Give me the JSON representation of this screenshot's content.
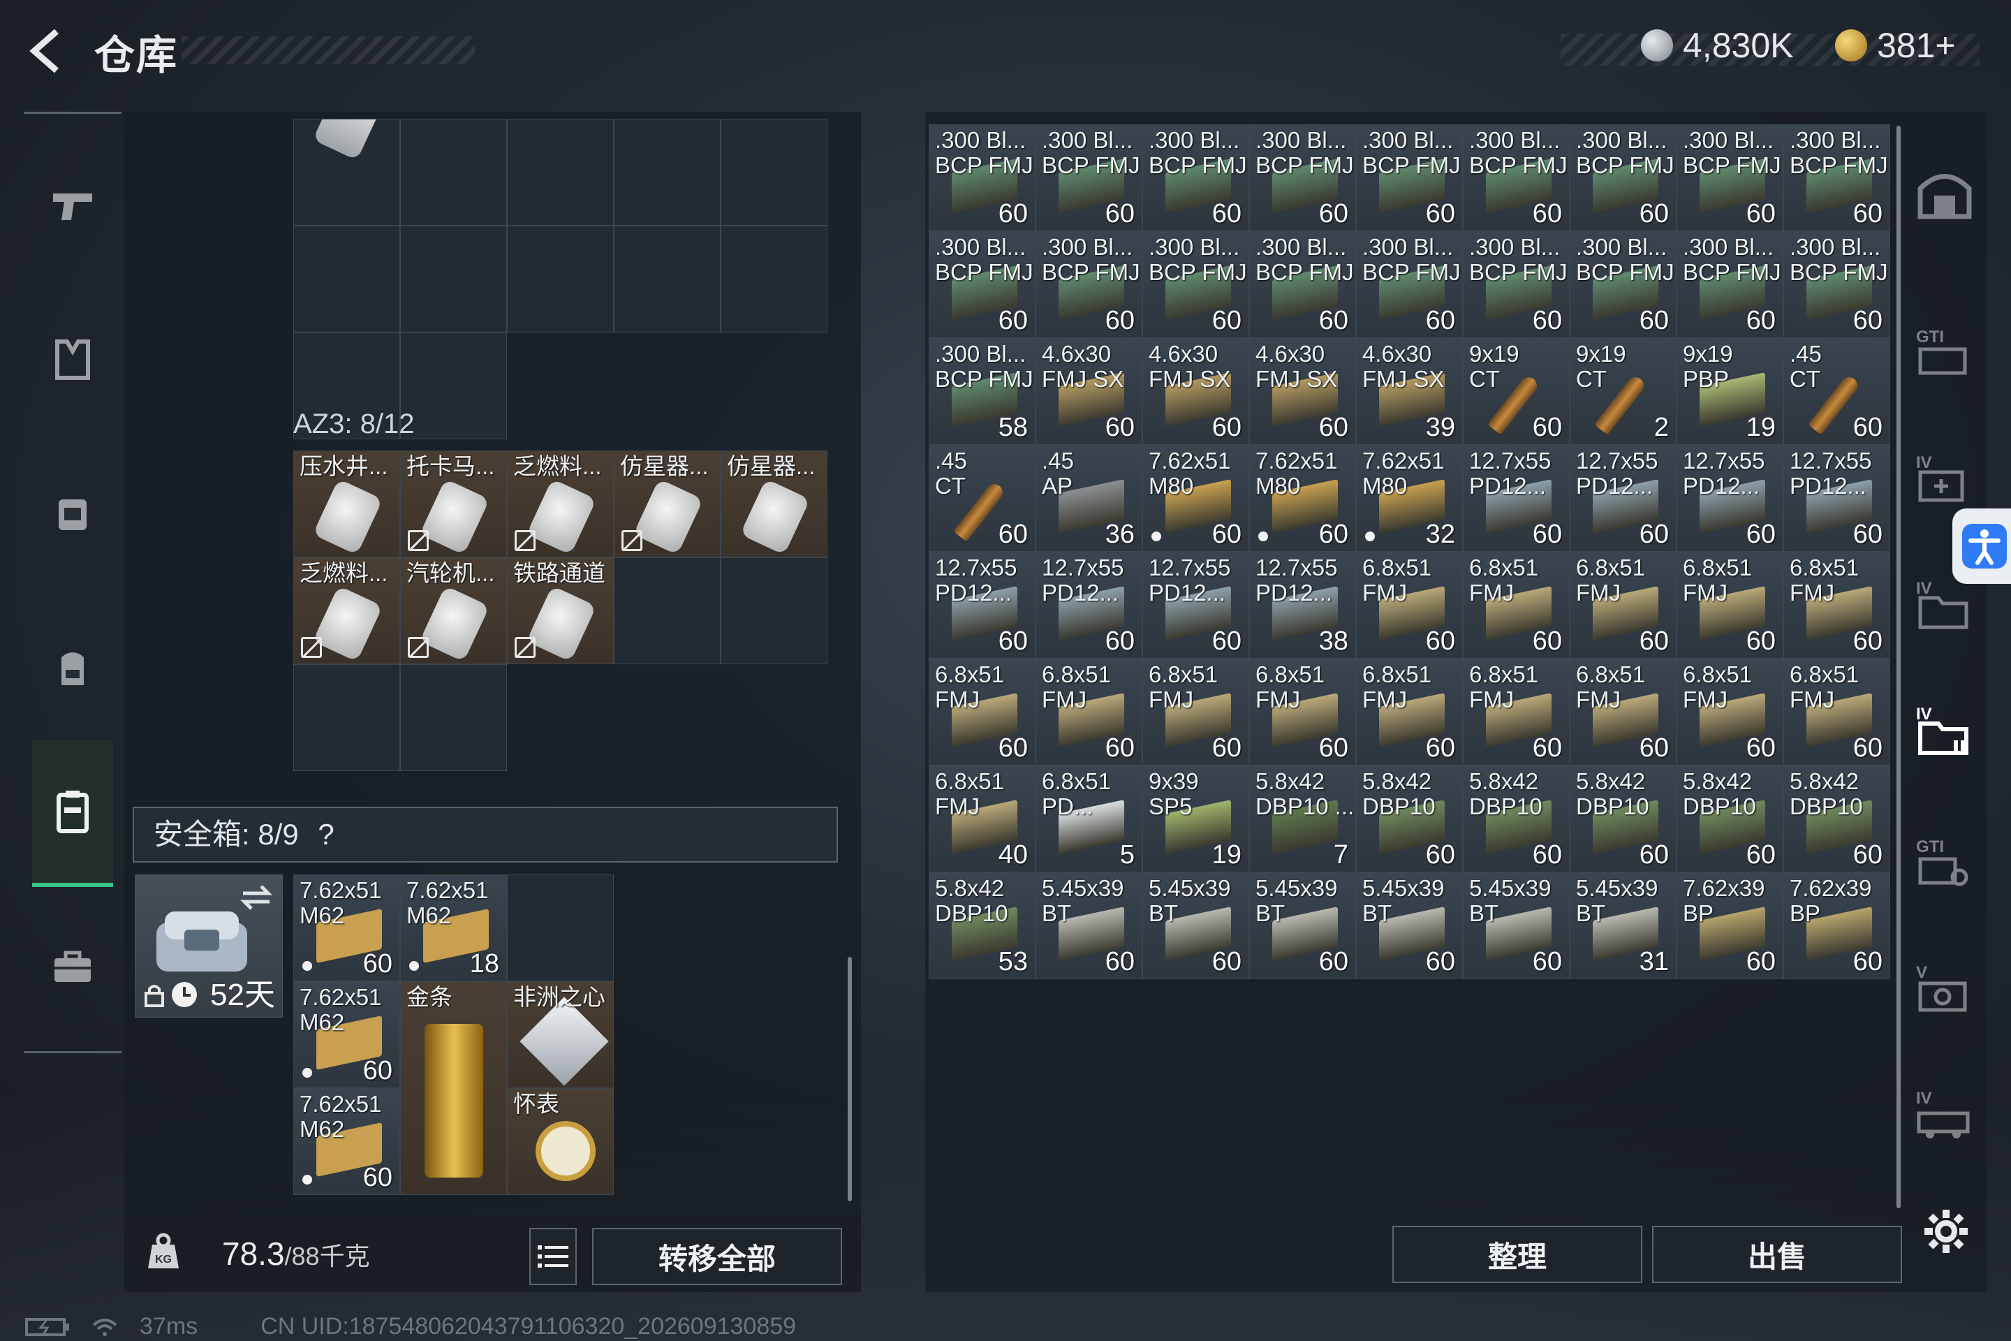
{
  "header": {
    "title": "仓库",
    "currency1": "4,830K",
    "currency2": "381+",
    "plus": "+"
  },
  "sidebar": [
    {
      "icon": "pistol-icon"
    },
    {
      "icon": "armor-vest-icon"
    },
    {
      "icon": "tactical-rig-icon"
    },
    {
      "icon": "backpack-icon"
    },
    {
      "icon": "container-icon"
    },
    {
      "icon": "briefcase-icon"
    }
  ],
  "left": {
    "az3_label": "AZ3: 8/12",
    "az3_items": [
      {
        "name": "压水井...",
        "nocard": false
      },
      {
        "name": "托卡马...",
        "nocard": true
      },
      {
        "name": "乏燃料...",
        "nocard": true
      },
      {
        "name": "仿星器...",
        "nocard": true
      },
      {
        "name": "仿星器...",
        "nocard": false
      },
      {
        "name": "乏燃料...",
        "nocard": true
      },
      {
        "name": "汽轮机...",
        "nocard": true
      },
      {
        "name": "铁路通道",
        "nocard": true
      }
    ],
    "safe_label": "安全箱: 8/9",
    "safe_help": "?",
    "case_days": "52天",
    "safe_items": [
      {
        "name": "7.62x51\nM62",
        "count": "60",
        "dot": true
      },
      {
        "name": "7.62x51\nM62",
        "count": "18",
        "dot": true
      },
      {
        "name": "7.62x51\nM62",
        "count": "60",
        "dot": true
      },
      {
        "name": "金条",
        "count": ""
      },
      {
        "name": "非洲之心",
        "count": ""
      },
      {
        "name": "7.62x51\nM62",
        "count": "60",
        "dot": true
      },
      {
        "name": "怀表",
        "count": ""
      }
    ],
    "weight_value": "78.3",
    "weight_cap": "/88千克",
    "transfer_all": "转移全部"
  },
  "stash": {
    "items": [
      {
        "name": ".300 Bl...\nBCP FMJ",
        "count": "60",
        "color": "#5f8a6e"
      },
      {
        "name": ".300 Bl...\nBCP FMJ",
        "count": "60",
        "color": "#5f8a6e"
      },
      {
        "name": ".300 Bl...\nBCP FMJ",
        "count": "60",
        "color": "#5f8a6e"
      },
      {
        "name": ".300 Bl...\nBCP FMJ",
        "count": "60",
        "color": "#5f8a6e"
      },
      {
        "name": ".300 Bl...\nBCP FMJ",
        "count": "60",
        "color": "#5f8a6e"
      },
      {
        "name": ".300 Bl...\nBCP FMJ",
        "count": "60",
        "color": "#5f8a6e"
      },
      {
        "name": ".300 Bl...\nBCP FMJ",
        "count": "60",
        "color": "#5f8a6e"
      },
      {
        "name": ".300 Bl...\nBCP FMJ",
        "count": "60",
        "color": "#5f8a6e"
      },
      {
        "name": ".300 Bl...\nBCP FMJ",
        "count": "60",
        "color": "#5f8a6e"
      },
      {
        "name": ".300 Bl...\nBCP FMJ",
        "count": "60",
        "color": "#5f8a6e"
      },
      {
        "name": ".300 Bl...\nBCP FMJ",
        "count": "60",
        "color": "#5f8a6e"
      },
      {
        "name": ".300 Bl...\nBCP FMJ",
        "count": "60",
        "color": "#5f8a6e"
      },
      {
        "name": ".300 Bl...\nBCP FMJ",
        "count": "60",
        "color": "#5f8a6e"
      },
      {
        "name": ".300 Bl...\nBCP FMJ",
        "count": "60",
        "color": "#5f8a6e"
      },
      {
        "name": ".300 Bl...\nBCP FMJ",
        "count": "60",
        "color": "#5f8a6e"
      },
      {
        "name": ".300 Bl...\nBCP FMJ",
        "count": "60",
        "color": "#5f8a6e"
      },
      {
        "name": ".300 Bl...\nBCP FMJ",
        "count": "60",
        "color": "#5f8a6e"
      },
      {
        "name": ".300 Bl...\nBCP FMJ",
        "count": "60",
        "color": "#5f8a6e"
      },
      {
        "name": ".300 Bl...\nBCP FMJ",
        "count": "58",
        "color": "#5f8a6e"
      },
      {
        "name": "4.6x30\nFMJ SX",
        "count": "60",
        "color": "#b49a62"
      },
      {
        "name": "4.6x30\nFMJ SX",
        "count": "60",
        "color": "#b49a62"
      },
      {
        "name": "4.6x30\nFMJ SX",
        "count": "60",
        "color": "#b49a62"
      },
      {
        "name": "4.6x30\nFMJ SX",
        "count": "39",
        "color": "#b49a62"
      },
      {
        "name": "9x19\nCT",
        "count": "60",
        "color": "shell"
      },
      {
        "name": "9x19\nCT",
        "count": "2",
        "color": "shell"
      },
      {
        "name": "9x19\nPBP",
        "count": "19",
        "color": "#a8b872"
      },
      {
        "name": ".45\nCT",
        "count": "60",
        "color": "shell"
      },
      {
        "name": ".45\nCT",
        "count": "60",
        "color": "shell"
      },
      {
        "name": ".45\nAP",
        "count": "36",
        "color": "#8c8f92"
      },
      {
        "name": "7.62x51\nM80",
        "count": "60",
        "color": "#c8a050",
        "dot": true
      },
      {
        "name": "7.62x51\nM80",
        "count": "60",
        "color": "#c8a050",
        "dot": true
      },
      {
        "name": "7.62x51\nM80",
        "count": "32",
        "color": "#c8a050",
        "dot": true
      },
      {
        "name": "12.7x55\nPD12...",
        "count": "60",
        "color": "#8da0aa"
      },
      {
        "name": "12.7x55\nPD12...",
        "count": "60",
        "color": "#8da0aa"
      },
      {
        "name": "12.7x55\nPD12...",
        "count": "60",
        "color": "#8da0aa"
      },
      {
        "name": "12.7x55\nPD12...",
        "count": "60",
        "color": "#8da0aa"
      },
      {
        "name": "12.7x55\nPD12...",
        "count": "60",
        "color": "#8da0aa"
      },
      {
        "name": "12.7x55\nPD12...",
        "count": "60",
        "color": "#8da0aa"
      },
      {
        "name": "12.7x55\nPD12...",
        "count": "60",
        "color": "#8da0aa"
      },
      {
        "name": "12.7x55\nPD12...",
        "count": "38",
        "color": "#8da0aa"
      },
      {
        "name": "6.8x51\nFMJ",
        "count": "60",
        "color": "#b9a878"
      },
      {
        "name": "6.8x51\nFMJ",
        "count": "60",
        "color": "#b9a878"
      },
      {
        "name": "6.8x51\nFMJ",
        "count": "60",
        "color": "#b9a878"
      },
      {
        "name": "6.8x51\nFMJ",
        "count": "60",
        "color": "#b9a878"
      },
      {
        "name": "6.8x51\nFMJ",
        "count": "60",
        "color": "#b9a878"
      },
      {
        "name": "6.8x51\nFMJ",
        "count": "60",
        "color": "#b9a878"
      },
      {
        "name": "6.8x51\nFMJ",
        "count": "60",
        "color": "#b9a878"
      },
      {
        "name": "6.8x51\nFMJ",
        "count": "60",
        "color": "#b9a878"
      },
      {
        "name": "6.8x51\nFMJ",
        "count": "60",
        "color": "#b9a878"
      },
      {
        "name": "6.8x51\nFMJ",
        "count": "60",
        "color": "#b9a878"
      },
      {
        "name": "6.8x51\nFMJ",
        "count": "60",
        "color": "#b9a878"
      },
      {
        "name": "6.8x51\nFMJ",
        "count": "60",
        "color": "#b9a878"
      },
      {
        "name": "6.8x51\nFMJ",
        "count": "60",
        "color": "#b9a878"
      },
      {
        "name": "6.8x51\nFMJ",
        "count": "60",
        "color": "#b9a878"
      },
      {
        "name": "6.8x51\nFMJ",
        "count": "40",
        "color": "#b9a878"
      },
      {
        "name": "6.8x51\nPD...",
        "count": "5",
        "color": "#d9dde0"
      },
      {
        "name": "9x39\nSP5",
        "count": "19",
        "color": "#9fb36c"
      },
      {
        "name": "5.8x42\nDBP10 ...",
        "count": "7",
        "color": "#5e7a4e"
      },
      {
        "name": "5.8x42\nDBP10",
        "count": "60",
        "color": "#6f8a5e"
      },
      {
        "name": "5.8x42\nDBP10",
        "count": "60",
        "color": "#6f8a5e"
      },
      {
        "name": "5.8x42\nDBP10",
        "count": "60",
        "color": "#6f8a5e"
      },
      {
        "name": "5.8x42\nDBP10",
        "count": "60",
        "color": "#6f8a5e"
      },
      {
        "name": "5.8x42\nDBP10",
        "count": "60",
        "color": "#6f8a5e"
      },
      {
        "name": "5.8x42\nDBP10",
        "count": "53",
        "color": "#6f8a5e"
      },
      {
        "name": "5.45x39\nBT",
        "count": "60",
        "color": "#b8b8b0"
      },
      {
        "name": "5.45x39\nBT",
        "count": "60",
        "color": "#b8b8b0"
      },
      {
        "name": "5.45x39\nBT",
        "count": "60",
        "color": "#b8b8b0"
      },
      {
        "name": "5.45x39\nBT",
        "count": "60",
        "color": "#b8b8b0"
      },
      {
        "name": "5.45x39\nBT",
        "count": "60",
        "color": "#b8b8b0"
      },
      {
        "name": "5.45x39\nBT",
        "count": "31",
        "color": "#b8b8b0"
      },
      {
        "name": "7.62x39\nBP",
        "count": "60",
        "color": "#b6a46c"
      },
      {
        "name": "7.62x39\nBP",
        "count": "60",
        "color": "#b6a46c"
      }
    ]
  },
  "buttons": {
    "organize": "整理",
    "sell": "出售"
  },
  "status": {
    "ping": "37ms",
    "uid": "CN UID:187548062043791106320_202609130859"
  }
}
